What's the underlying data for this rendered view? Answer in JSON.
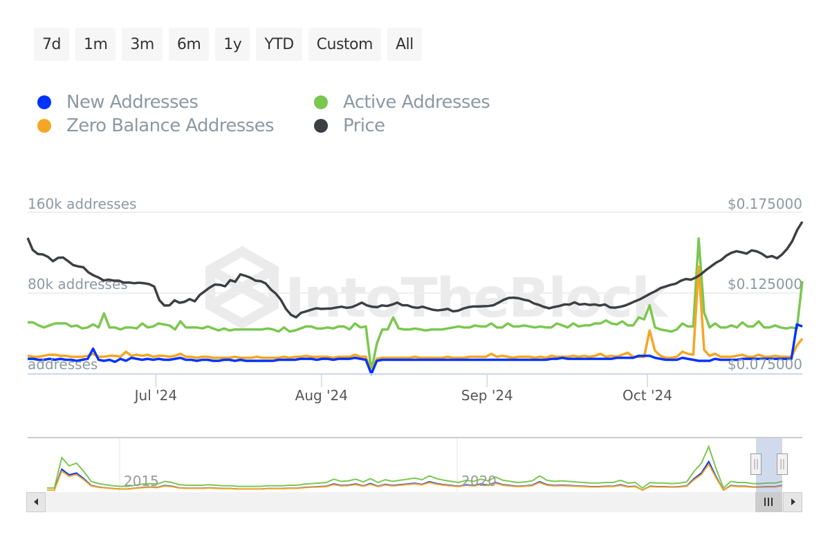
{
  "range_buttons": [
    "7d",
    "1m",
    "3m",
    "6m",
    "1y",
    "YTD",
    "Custom",
    "All"
  ],
  "legend": [
    {
      "label": "New Addresses",
      "color": "#0033ff"
    },
    {
      "label": "Active Addresses",
      "color": "#7ac74f"
    },
    {
      "label": "Zero Balance Addresses",
      "color": "#f5a623"
    },
    {
      "label": "Price",
      "color": "#3c3f43"
    }
  ],
  "watermark": "IntoTheBlock",
  "chart_data": {
    "type": "line",
    "title": "",
    "left_axis": {
      "unit": "addresses",
      "ticks": [
        {
          "value": 0,
          "label": "addresses"
        },
        {
          "value": 80000,
          "label": "80k addresses"
        },
        {
          "value": 160000,
          "label": "160k addresses"
        }
      ],
      "range": [
        0,
        160000
      ]
    },
    "right_axis": {
      "unit": "USD",
      "ticks": [
        {
          "value": 0.075,
          "label": "$0.075000"
        },
        {
          "value": 0.125,
          "label": "$0.125000"
        },
        {
          "value": 0.175,
          "label": "$0.175000"
        }
      ],
      "range": [
        0.075,
        0.175
      ]
    },
    "x_ticks": [
      "Jul '24",
      "Aug '24",
      "Sep '24",
      "Oct '24"
    ],
    "x_tick_positions_days": [
      24,
      55,
      86,
      116
    ],
    "x_days_range": [
      0,
      145
    ],
    "grid": true,
    "legend_position": "top-left",
    "series": [
      {
        "name": "Active Addresses",
        "axis": "left",
        "color": "#7ac74f",
        "values": [
          51000,
          51000,
          48000,
          46000,
          48000,
          50000,
          50000,
          50000,
          47000,
          48000,
          45000,
          46000,
          49000,
          46000,
          60000,
          46000,
          46000,
          44000,
          46000,
          46000,
          45000,
          50000,
          46000,
          47000,
          50000,
          49000,
          48000,
          44000,
          52000,
          46000,
          46000,
          46000,
          45000,
          47000,
          45000,
          43000,
          45000,
          43000,
          44000,
          44000,
          44000,
          44000,
          44000,
          44000,
          45000,
          44000,
          42000,
          46000,
          42000,
          43000,
          45000,
          47000,
          47000,
          45000,
          45000,
          46000,
          45000,
          47000,
          47000,
          44000,
          50000,
          46000,
          47000,
          3000,
          30000,
          44000,
          44000,
          56000,
          45000,
          44000,
          44000,
          45000,
          44000,
          43000,
          44000,
          44000,
          44000,
          45000,
          46000,
          47000,
          46000,
          46000,
          48000,
          47000,
          47000,
          50000,
          46000,
          46000,
          50000,
          47000,
          47000,
          48000,
          47000,
          46000,
          47000,
          46000,
          46000,
          50000,
          48000,
          46000,
          50000,
          47000,
          48000,
          48000,
          50000,
          50000,
          53000,
          50000,
          49000,
          52000,
          48000,
          48000,
          56000,
          54000,
          68000,
          46000,
          44000,
          43000,
          42000,
          44000,
          50000,
          47000,
          47000,
          134000,
          61000,
          46000,
          50000,
          46000,
          46000,
          48000,
          46000,
          51000,
          47000,
          47000,
          52000,
          46000,
          46000,
          48000,
          46000,
          45000,
          46000,
          45000,
          92000
        ]
      },
      {
        "name": "Zero Balance Addresses",
        "axis": "left",
        "color": "#f5a623",
        "values": [
          18000,
          17000,
          17000,
          18000,
          19000,
          19000,
          18000,
          18000,
          17000,
          17000,
          17000,
          18000,
          20000,
          17000,
          17000,
          18000,
          18000,
          17000,
          22000,
          18000,
          19000,
          18000,
          19000,
          17000,
          18000,
          18000,
          17000,
          18000,
          20000,
          17000,
          17000,
          16000,
          17000,
          17000,
          16000,
          16000,
          16000,
          16000,
          17000,
          16000,
          16000,
          16000,
          17000,
          16000,
          16000,
          16000,
          16000,
          17000,
          16000,
          17000,
          17000,
          18000,
          17000,
          17000,
          17000,
          17000,
          16000,
          17000,
          17000,
          17000,
          19000,
          17000,
          17000,
          1000,
          15000,
          16000,
          16000,
          16000,
          16000,
          16000,
          16000,
          17000,
          16000,
          16000,
          16000,
          16000,
          16000,
          17000,
          16000,
          16000,
          16000,
          17000,
          17000,
          17000,
          17000,
          20000,
          17000,
          18000,
          17000,
          16000,
          17000,
          17000,
          17000,
          16000,
          17000,
          16000,
          18000,
          17000,
          17000,
          17000,
          18000,
          17000,
          18000,
          17000,
          18000,
          20000,
          17000,
          18000,
          17000,
          19000,
          21000,
          17000,
          17000,
          17000,
          43000,
          23000,
          18000,
          16000,
          16000,
          17000,
          22000,
          20000,
          19000,
          106000,
          24000,
          18000,
          20000,
          17000,
          17000,
          17000,
          18000,
          19000,
          17000,
          17000,
          19000,
          17000,
          17000,
          18000,
          17000,
          17000,
          17000,
          28000,
          35000
        ]
      },
      {
        "name": "New Addresses",
        "axis": "left",
        "color": "#0033ff",
        "values": [
          15000,
          15000,
          14000,
          14000,
          15000,
          14000,
          15000,
          14000,
          14000,
          13000,
          14000,
          15000,
          25000,
          14000,
          13000,
          14000,
          12000,
          15000,
          13000,
          16000,
          15000,
          14000,
          15000,
          14000,
          15000,
          14000,
          14000,
          15000,
          16000,
          14000,
          14000,
          13000,
          14000,
          14000,
          13000,
          13000,
          14000,
          14000,
          13000,
          14000,
          13000,
          13000,
          13000,
          13000,
          13000,
          13000,
          14000,
          14000,
          14000,
          14000,
          15000,
          15000,
          15000,
          14000,
          15000,
          15000,
          14000,
          15000,
          15000,
          15000,
          16000,
          15000,
          14000,
          0,
          13000,
          14000,
          14000,
          14000,
          14000,
          14000,
          14000,
          14000,
          14000,
          14000,
          14000,
          14000,
          14000,
          14000,
          14000,
          14000,
          14000,
          14000,
          14000,
          14000,
          14000,
          14000,
          14000,
          14000,
          14000,
          14000,
          14000,
          14000,
          14000,
          14000,
          14000,
          14000,
          15000,
          15000,
          16000,
          15000,
          15000,
          15000,
          15000,
          15000,
          15000,
          15000,
          15000,
          15000,
          16000,
          16000,
          16000,
          16000,
          18000,
          18000,
          18000,
          16000,
          15000,
          14000,
          14000,
          14000,
          16000,
          15000,
          14000,
          13000,
          13000,
          13000,
          15000,
          14000,
          14000,
          14000,
          14000,
          15000,
          15000,
          15000,
          15000,
          15000,
          15000,
          15000,
          15000,
          15000,
          15000,
          49000,
          47000
        ]
      },
      {
        "name": "Price",
        "axis": "right",
        "color": "#3c3f43",
        "values": [
          0.1591,
          0.1517,
          0.1492,
          0.1489,
          0.1474,
          0.1447,
          0.1468,
          0.147,
          0.1447,
          0.1423,
          0.1415,
          0.141,
          0.1378,
          0.136,
          0.1346,
          0.1328,
          0.1333,
          0.1327,
          0.1327,
          0.1314,
          0.1316,
          0.1311,
          0.1314,
          0.1311,
          0.1305,
          0.129,
          0.1207,
          0.1173,
          0.1174,
          0.1205,
          0.119,
          0.1196,
          0.1213,
          0.1199,
          0.1239,
          0.1262,
          0.1285,
          0.1303,
          0.1301,
          0.1292,
          0.133,
          0.132,
          0.1366,
          0.1357,
          0.1345,
          0.1327,
          0.1324,
          0.131,
          0.1273,
          0.1247,
          0.1209,
          0.1153,
          0.1116,
          0.11,
          0.1128,
          0.1137,
          0.1147,
          0.1156,
          0.1152,
          0.1154,
          0.1155,
          0.1161,
          0.1166,
          0.1159,
          0.1163,
          0.1176,
          0.1191,
          0.1174,
          0.1166,
          0.1163,
          0.1174,
          0.117,
          0.1179,
          0.1191,
          0.1175,
          0.1175,
          0.1163,
          0.1159,
          0.1166,
          0.1156,
          0.1147,
          0.1143,
          0.1147,
          0.1152,
          0.1137,
          0.1141,
          0.1154,
          0.1163,
          0.1167,
          0.1167,
          0.1169,
          0.117,
          0.1175,
          0.1191,
          0.1208,
          0.122,
          0.1222,
          0.1218,
          0.1209,
          0.1203,
          0.1186,
          0.1177,
          0.1164,
          0.1156,
          0.1164,
          0.117,
          0.118,
          0.1179,
          0.1193,
          0.1179,
          0.1183,
          0.1177,
          0.118,
          0.1173,
          0.118,
          0.1162,
          0.116,
          0.1165,
          0.1173,
          0.1186,
          0.12,
          0.1213,
          0.123,
          0.1247,
          0.1262,
          0.1281,
          0.1291,
          0.1301,
          0.1308,
          0.1326,
          0.1337,
          0.1333,
          0.1347,
          0.1367,
          0.1393,
          0.1416,
          0.1439,
          0.1455,
          0.1482,
          0.1499,
          0.1509,
          0.1502,
          0.1494,
          0.1514,
          0.1508,
          0.1493,
          0.1472,
          0.1479,
          0.1465,
          0.1489,
          0.1523,
          0.1571,
          0.1641,
          0.1691
        ]
      }
    ],
    "navigator": {
      "x_labels": [
        "2015",
        "2020"
      ],
      "selection": "last ~5 months (Jun–Oct 2024)"
    }
  }
}
